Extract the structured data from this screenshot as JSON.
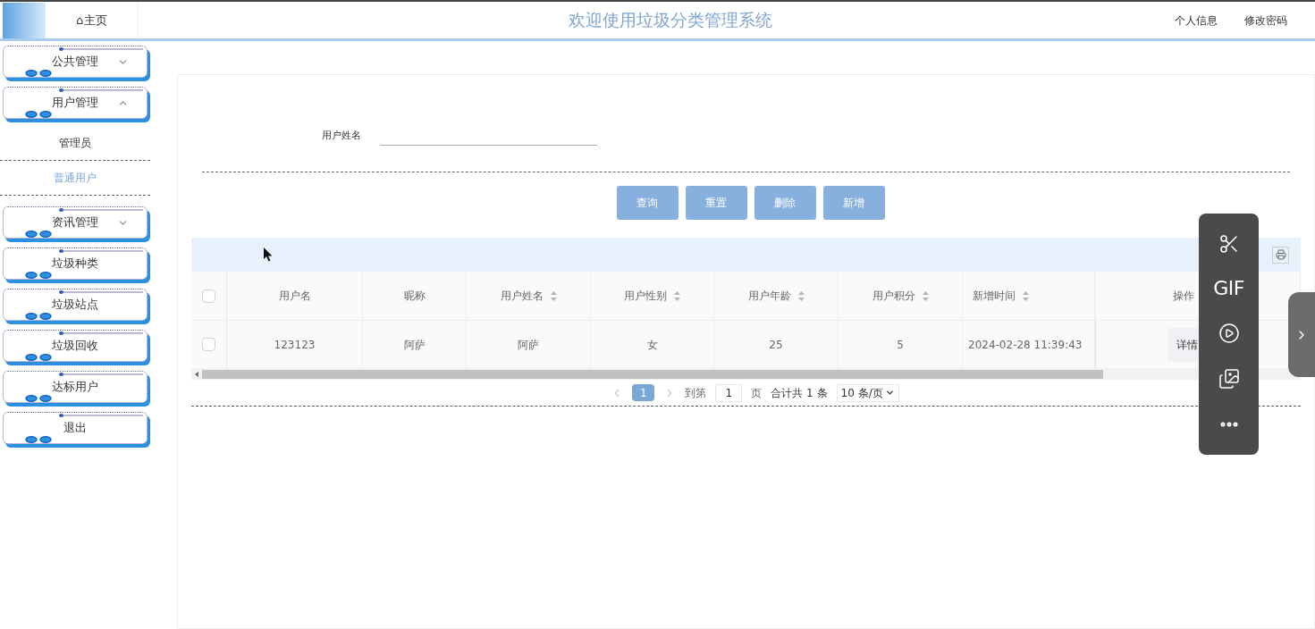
{
  "header": {
    "home_tab": "⌂主页",
    "title": "欢迎使用垃圾分类管理系统",
    "links": [
      "个人信息",
      "修改密码"
    ]
  },
  "sidebar": {
    "items": [
      {
        "label": "公共管理",
        "expanded": false
      },
      {
        "label": "用户管理",
        "expanded": true,
        "children": [
          {
            "label": "管理员",
            "selected": false
          },
          {
            "label": "普通用户",
            "selected": true
          }
        ]
      },
      {
        "label": "资讯管理",
        "expanded": false
      },
      {
        "label": "垃圾种类"
      },
      {
        "label": "垃圾站点"
      },
      {
        "label": "垃圾回收"
      },
      {
        "label": "达标用户"
      },
      {
        "label": "退出"
      }
    ]
  },
  "search": {
    "label": "用户姓名"
  },
  "buttons": [
    "查询",
    "重置",
    "删除",
    "新增"
  ],
  "table": {
    "columns": [
      {
        "label": "用户名",
        "sortable": false
      },
      {
        "label": "昵称",
        "sortable": false
      },
      {
        "label": "用户姓名",
        "sortable": true
      },
      {
        "label": "用户性别",
        "sortable": true
      },
      {
        "label": "用户年龄",
        "sortable": true
      },
      {
        "label": "用户积分",
        "sortable": true
      },
      {
        "label": "新增时间",
        "sortable": true
      },
      {
        "label": "操作"
      }
    ],
    "rows": [
      {
        "checked": false,
        "cells": [
          "123123",
          "阿萨",
          "阿萨",
          "女",
          "25",
          "5",
          "2024-02-28 11:39:43"
        ],
        "action": "详情"
      }
    ],
    "header_checked": false
  },
  "pagination": {
    "pages": [
      {
        "label": "1",
        "selected": true
      }
    ],
    "goto_label": "到第",
    "goto_value": "1",
    "page_unit": "页",
    "total": "合计共 1 条",
    "page_size": "10 条/页"
  },
  "overlay": {
    "gif_label": "GIF"
  }
}
